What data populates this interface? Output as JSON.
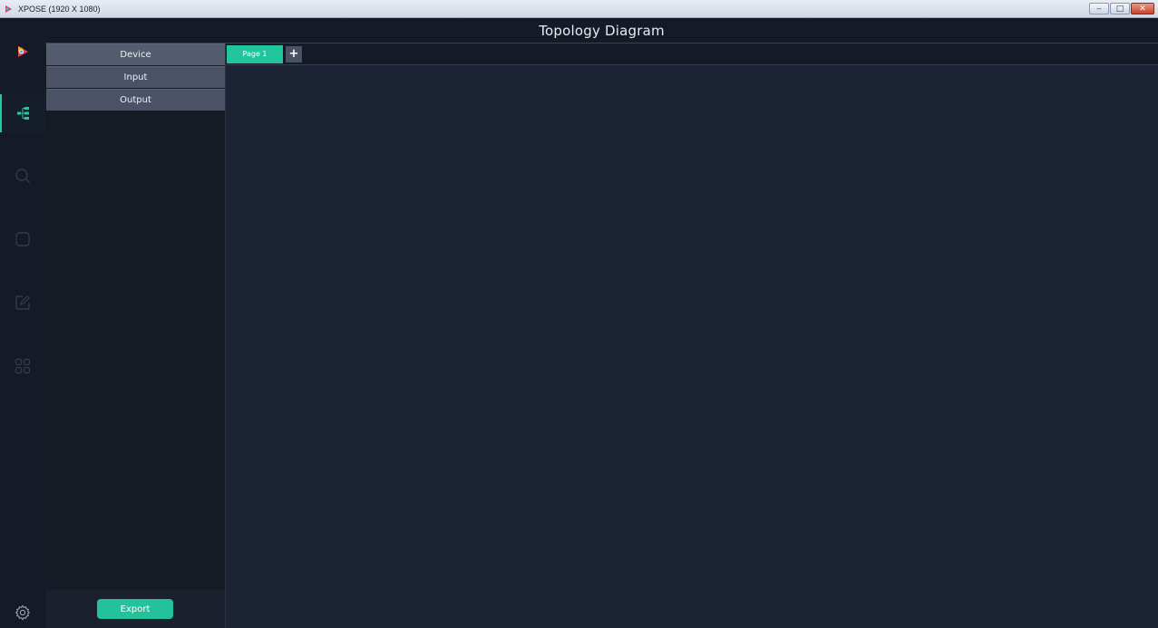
{
  "window": {
    "title": "XPOSE (1920 X 1080)",
    "controls": {
      "minimize": "‒",
      "maximize": "□",
      "close": "✕"
    }
  },
  "header": {
    "title": "Topology Diagram"
  },
  "icon_rail": [
    {
      "icon": "logo-play-icon",
      "active": false
    },
    {
      "icon": "topology-icon",
      "active": true
    },
    {
      "icon": "search-icon",
      "active": false
    },
    {
      "icon": "layer-icon",
      "active": false
    },
    {
      "icon": "edit-icon",
      "active": false
    },
    {
      "icon": "grid-icon",
      "active": false
    },
    {
      "icon": "settings-icon",
      "active": false
    }
  ],
  "sidebar": {
    "tabs": [
      {
        "label": "Device"
      },
      {
        "label": "Input"
      },
      {
        "label": "Output"
      }
    ],
    "export_label": "Export"
  },
  "canvas": {
    "pages": [
      {
        "label": "Page 1",
        "active": true
      }
    ],
    "add_page_label": "+"
  },
  "colors": {
    "accent": "#22c39b",
    "background": "#1c2334",
    "rail": "#141a26"
  }
}
